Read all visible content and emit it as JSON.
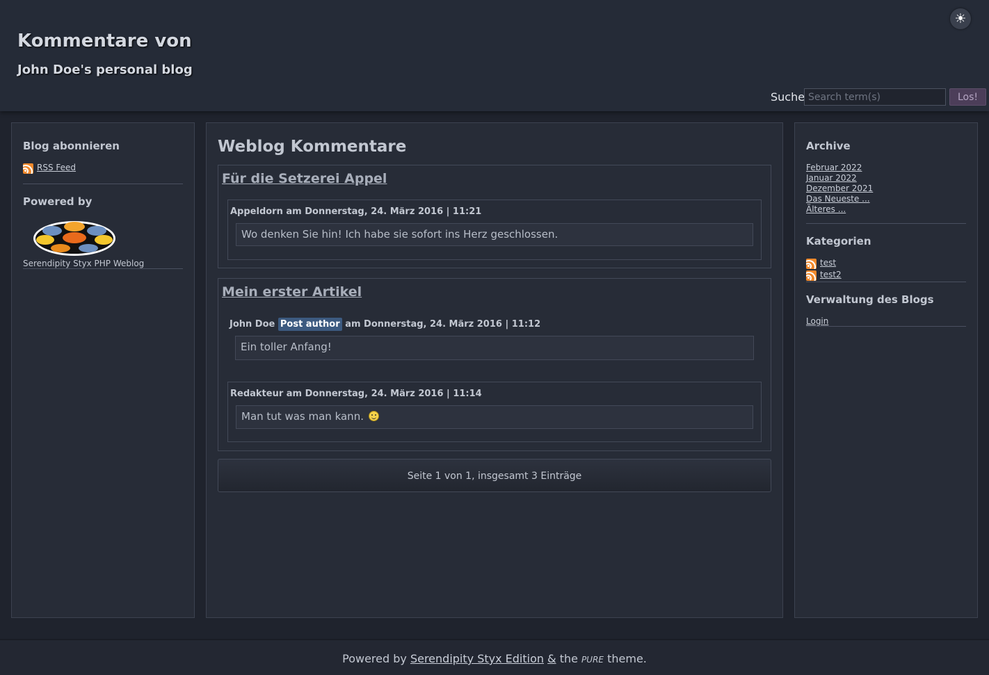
{
  "header": {
    "title": "Kommentare von",
    "description": "John Doe's personal blog",
    "theme_toggle_icon": "sun-icon",
    "search_label": "Suche",
    "search_placeholder": "Search term(s)",
    "search_button": "Los!"
  },
  "sidebar_left": {
    "subscribe_title": "Blog abonnieren",
    "rss_link": "RSS Feed",
    "powered_title": "Powered by",
    "powered_caption": "Serendipity Styx PHP Weblog"
  },
  "main": {
    "heading": "Weblog Kommentare",
    "entries": [
      {
        "title": "Für die Setzerei Appel",
        "comments": [
          {
            "meta": "Appeldorn am Donnerstag, 24. März 2016 | 11:21",
            "body": "Wo denken Sie hin! Ich habe sie sofort ins Herz geschlossen."
          }
        ]
      },
      {
        "title": "Mein erster Artikel",
        "comments": [
          {
            "author": "John Doe",
            "badge": "Post author",
            "meta_rest": "am Donnerstag, 24. März 2016 | 11:12",
            "body": "Ein toller Anfang!"
          },
          {
            "meta": "Redakteur am Donnerstag, 24. März 2016 | 11:14",
            "body": "Man tut was man kann."
          }
        ]
      }
    ],
    "pagination": "Seite 1 von 1, insgesamt 3 Einträge"
  },
  "sidebar_right": {
    "archive_title": "Archive",
    "archive_links": [
      "Februar 2022",
      "Januar 2022",
      "Dezember 2021",
      "Das Neueste ...",
      "Älteres ..."
    ],
    "categories_title": "Kategorien",
    "categories": [
      "test",
      "test2"
    ],
    "admin_title": "Verwaltung des Blogs",
    "login_link": "Login"
  },
  "footer": {
    "prefix": "Powered by",
    "styx_link": "Serendipity Styx Edition",
    "amp": "&",
    "the": "the",
    "pure": "PURE",
    "suffix": "theme."
  },
  "colors": {
    "background": "#1f232d",
    "header": "#252b37",
    "panel": "#272c37",
    "rss": "#f0892c",
    "author_badge": "#3c5a80",
    "search_button": "#4c3e59"
  }
}
